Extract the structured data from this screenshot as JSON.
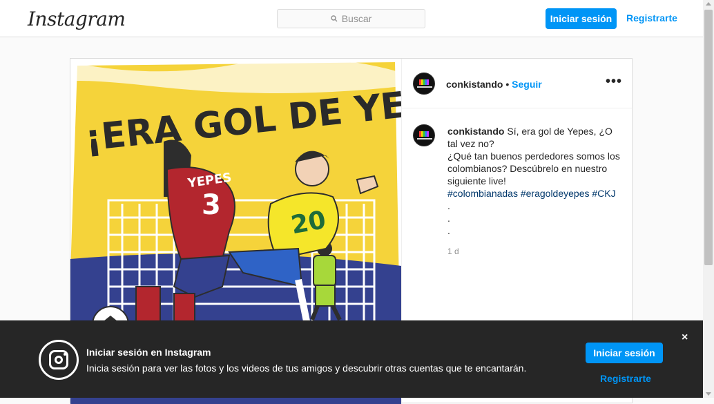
{
  "header": {
    "logo": "Instagram",
    "search_placeholder": "Buscar",
    "login_label": "Iniciar sesión",
    "register_label": "Registrarte"
  },
  "post": {
    "image_text": "¡ERA GOL DE YEPES!",
    "image_jersey_red_name": "YEPES",
    "image_jersey_red_number": "3",
    "image_jersey_yellow_number": "20",
    "username": "conkistando",
    "separator": "•",
    "follow_label": "Seguir",
    "more_icon": "more-horizontal-icon",
    "caption_user": "conkistando",
    "caption_line1": "Sí, era gol de Yepes, ¿O tal vez no?",
    "caption_line2": "¿Qué tan buenos perdedores somos los colombianos? Descúbrelo en nuestro siguiente live!",
    "hashtags": "#colombianadas #eragoldeyepes #CKJ",
    "dot1": ".",
    "dot2": ".",
    "dot3": ".",
    "time": "1 d"
  },
  "banner": {
    "title": "Iniciar sesión en Instagram",
    "text": "Inicia sesión para ver las fotos y los videos de tus amigos y descubrir otras cuentas que te encantarán.",
    "login_label": "Iniciar sesión",
    "register_label": "Registrarte",
    "close_label": "×"
  },
  "colors": {
    "accent": "#0095f6",
    "banner_bg": "#262626",
    "image_yellow": "#f5d33a",
    "image_blue": "#34418f",
    "image_red": "#b3262e"
  }
}
